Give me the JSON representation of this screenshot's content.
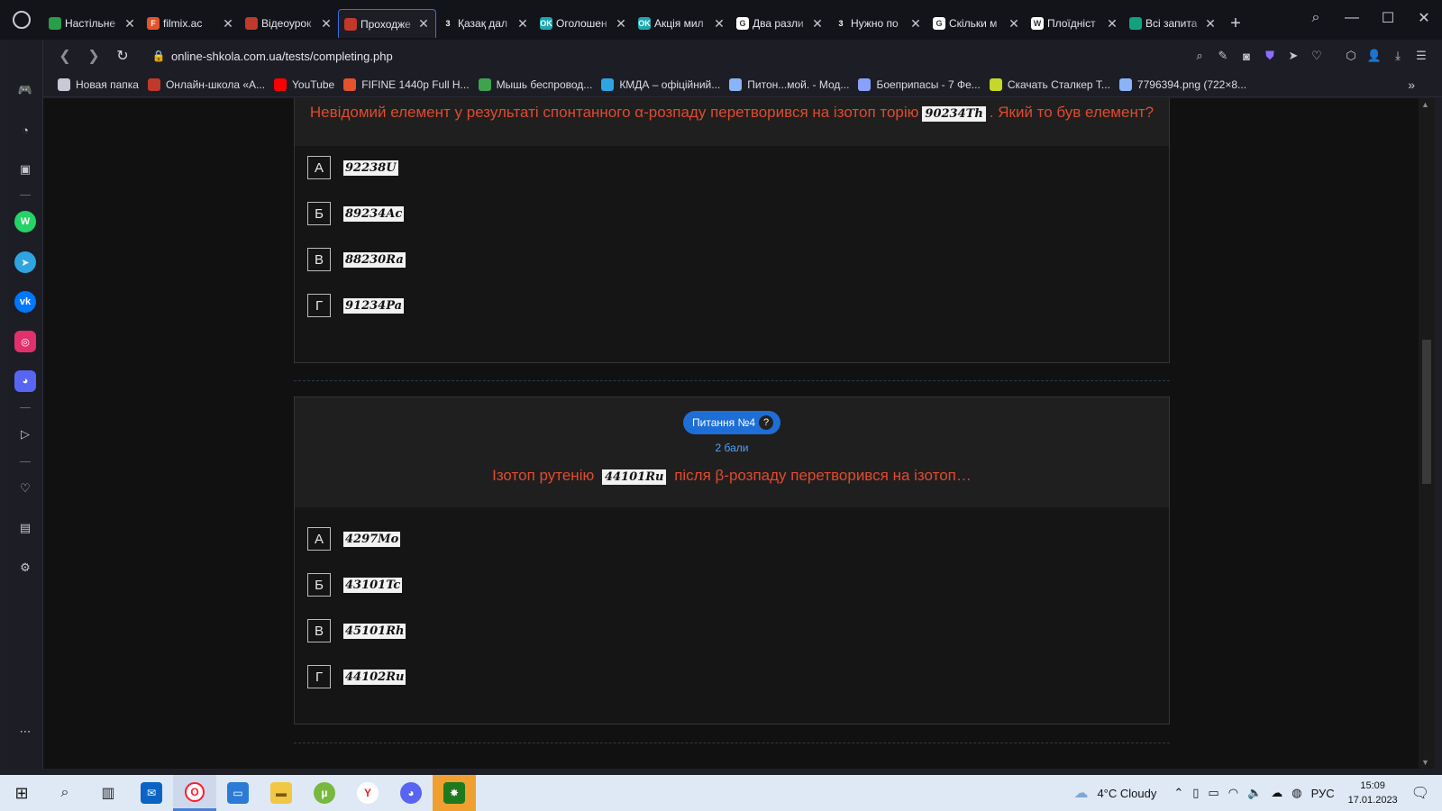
{
  "tabs": [
    {
      "title": "Настільне",
      "color": "#2a9d4a",
      "glyph": ""
    },
    {
      "title": "filmix.ac",
      "color": "#e5532d",
      "glyph": "F"
    },
    {
      "title": "Відеоурок",
      "color": "#c0392b",
      "glyph": ""
    },
    {
      "title": "Проходже",
      "color": "#c0392b",
      "glyph": ""
    },
    {
      "title": "Қазақ дал",
      "color": "#13131a",
      "glyph": "3"
    },
    {
      "title": "Оголошен",
      "color": "#19a9b0",
      "glyph": "OK"
    },
    {
      "title": "Акція мил",
      "color": "#19a9b0",
      "glyph": "OK"
    },
    {
      "title": "Два разли",
      "color": "#ffffff",
      "glyph": "G"
    },
    {
      "title": "Нужно по",
      "color": "#13131a",
      "glyph": "3"
    },
    {
      "title": "Скільки м",
      "color": "#ffffff",
      "glyph": "G"
    },
    {
      "title": "Плоїдніст",
      "color": "#ffffff",
      "glyph": "W"
    },
    {
      "title": "Всі запита",
      "color": "#10a37f",
      "glyph": ""
    }
  ],
  "active_tab_index": 3,
  "address": {
    "url": "online-shkola.com.ua/tests/completing.php"
  },
  "bookmarks": [
    {
      "label": "Новая папка",
      "color": "#c9c9d6"
    },
    {
      "label": "Онлайн-школа «А...",
      "color": "#c0392b"
    },
    {
      "label": "YouTube",
      "color": "#ff0000"
    },
    {
      "label": "FIFINE 1440p Full H...",
      "color": "#e5532d"
    },
    {
      "label": "Мышь беспровод...",
      "color": "#3fa34d"
    },
    {
      "label": "КМДА – офіційний...",
      "color": "#2ea5e0"
    },
    {
      "label": "Питон...мой. - Мод...",
      "color": "#8ab4f8"
    },
    {
      "label": "Боеприпасы - 7 Фе...",
      "color": "#8aa0ff"
    },
    {
      "label": "Скачать Сталкер Т...",
      "color": "#c3d82a"
    },
    {
      "label": "7796394.png (722×8...",
      "color": "#8ab4f8"
    }
  ],
  "question3": {
    "text_before": "Невідомий елемент у результаті спонтанного α-розпаду перетворився на ізотоп торію",
    "formula": "90234Th",
    "text_after": ". Який то був елемент?",
    "answers": [
      {
        "letter": "А",
        "formula": "92238U"
      },
      {
        "letter": "Б",
        "formula": "89234Ac"
      },
      {
        "letter": "В",
        "formula": "88230Ra"
      },
      {
        "letter": "Г",
        "formula": "91234Pa"
      }
    ]
  },
  "question4": {
    "badge": "Питання №4",
    "help": "?",
    "points": "2 бали",
    "text_before": "Ізотоп рутенію",
    "formula": "44101Ru",
    "text_after": "після β-розпаду перетворився на ізотоп…",
    "answers": [
      {
        "letter": "А",
        "formula": "4297Mo"
      },
      {
        "letter": "Б",
        "formula": "43101Tc"
      },
      {
        "letter": "В",
        "formula": "45101Rh"
      },
      {
        "letter": "Г",
        "formula": "44102Ru"
      }
    ]
  },
  "taskbar": {
    "weather": "4°C  Cloudy",
    "lang": "РУС",
    "time": "15:09",
    "date": "17.01.2023"
  }
}
